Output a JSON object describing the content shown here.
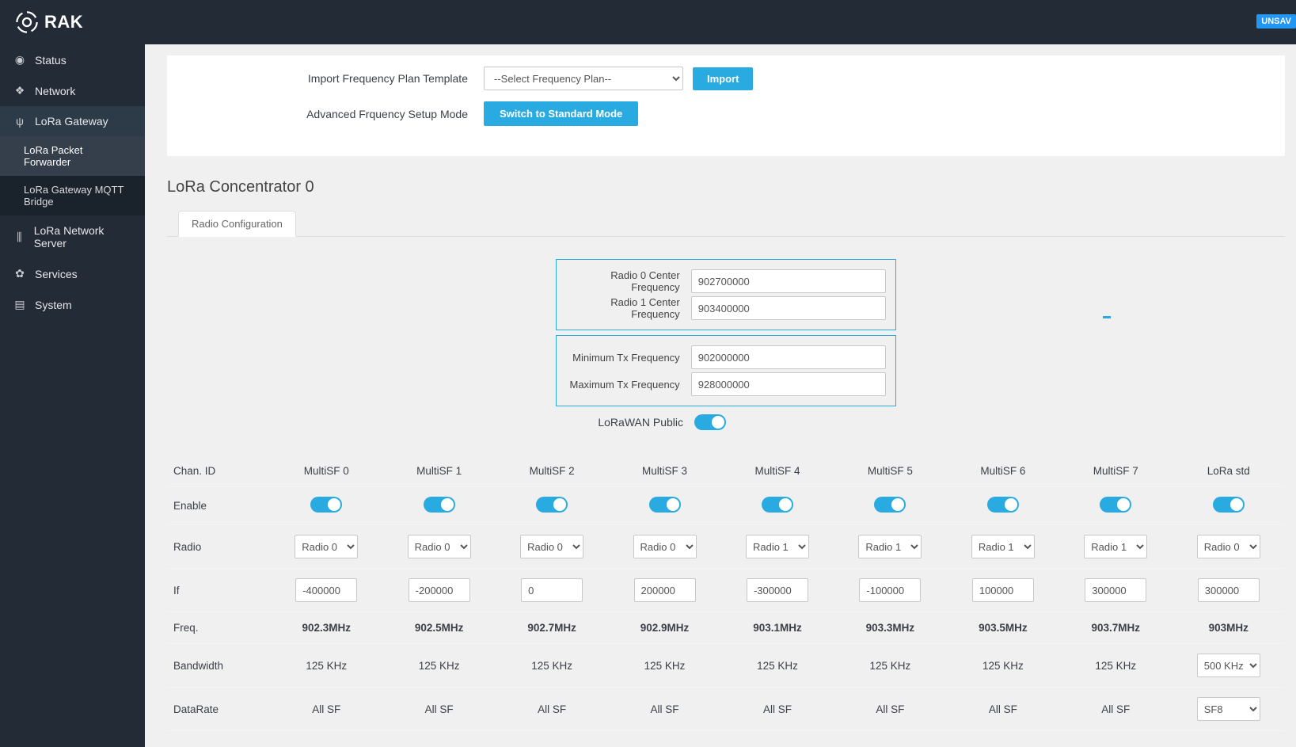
{
  "badge_unsaved": "UNSAV",
  "brand": "RAK",
  "sidebar": {
    "items": [
      "Status",
      "Network",
      "LoRa Gateway",
      "LoRa Network Server",
      "Services",
      "System"
    ],
    "sub": [
      "LoRa Packet Forwarder",
      "LoRa Gateway MQTT Bridge"
    ]
  },
  "top": {
    "import_label": "Import Frequency Plan Template",
    "import_select": "--Select Frequency Plan--",
    "import_btn": "Import",
    "mode_label": "Advanced Frquency Setup Mode",
    "mode_btn": "Switch to Standard Mode"
  },
  "section_title": "LoRa Concentrator 0",
  "tab": "Radio Configuration",
  "radio_form": {
    "r0_label": "Radio 0 Center Frequency",
    "r0_val": "902700000",
    "r1_label": "Radio 1 Center Frequency",
    "r1_val": "903400000",
    "min_label": "Minimum Tx Frequency",
    "min_val": "902000000",
    "max_label": "Maximum Tx Frequency",
    "max_val": "928000000",
    "public_label": "LoRaWAN Public"
  },
  "rows": {
    "chan": "Chan. ID",
    "enable": "Enable",
    "radio": "Radio",
    "if": "If",
    "freq": "Freq.",
    "bw": "Bandwidth",
    "dr": "DataRate"
  },
  "channels": [
    {
      "name": "MultiSF 0",
      "radio": "Radio 0",
      "if": "-400000",
      "freq": "902.3MHz",
      "bw": "125 KHz",
      "dr": "All SF"
    },
    {
      "name": "MultiSF 1",
      "radio": "Radio 0",
      "if": "-200000",
      "freq": "902.5MHz",
      "bw": "125 KHz",
      "dr": "All SF"
    },
    {
      "name": "MultiSF 2",
      "radio": "Radio 0",
      "if": "0",
      "freq": "902.7MHz",
      "bw": "125 KHz",
      "dr": "All SF"
    },
    {
      "name": "MultiSF 3",
      "radio": "Radio 0",
      "if": "200000",
      "freq": "902.9MHz",
      "bw": "125 KHz",
      "dr": "All SF"
    },
    {
      "name": "MultiSF 4",
      "radio": "Radio 1",
      "if": "-300000",
      "freq": "903.1MHz",
      "bw": "125 KHz",
      "dr": "All SF"
    },
    {
      "name": "MultiSF 5",
      "radio": "Radio 1",
      "if": "-100000",
      "freq": "903.3MHz",
      "bw": "125 KHz",
      "dr": "All SF"
    },
    {
      "name": "MultiSF 6",
      "radio": "Radio 1",
      "if": "100000",
      "freq": "903.5MHz",
      "bw": "125 KHz",
      "dr": "All SF"
    },
    {
      "name": "MultiSF 7",
      "radio": "Radio 1",
      "if": "300000",
      "freq": "903.7MHz",
      "bw": "125 KHz",
      "dr": "All SF"
    },
    {
      "name": "LoRa std",
      "radio": "Radio 0",
      "if": "300000",
      "freq": "903MHz",
      "bw": "500 KHz",
      "dr": "SF8",
      "bw_select": true,
      "dr_select": true
    }
  ]
}
